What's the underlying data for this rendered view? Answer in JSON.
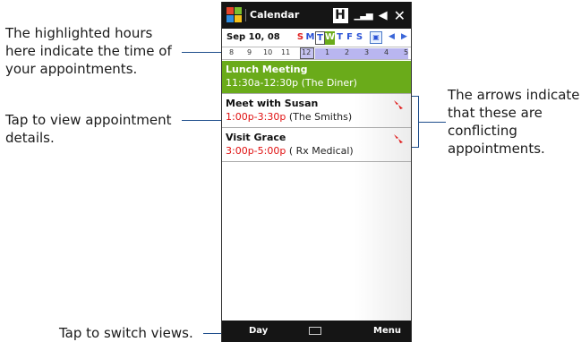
{
  "annotations": {
    "highlighted_hours": "The highlighted hours here indicate the time of your appointments.",
    "tap_view": "Tap to view appointment details.",
    "arrows": "The arrows indicate that these are conflicting appointments.",
    "switch_views": "Tap to switch views."
  },
  "phone": {
    "title": "Calendar",
    "status_h": "H",
    "date_label": "Sep 10, 08",
    "weekdays": [
      "S",
      "M",
      "T",
      "W",
      "T",
      "F",
      "S"
    ],
    "hours": [
      "8",
      "9",
      "10",
      "11",
      "12",
      "1",
      "2",
      "3",
      "4",
      "5"
    ],
    "appointments": [
      {
        "title": "Lunch Meeting",
        "time": "11:30a-12:30p",
        "location": "(The Diner)",
        "selected": true
      },
      {
        "title": "Meet with Susan",
        "time": "1:00p-3:30p",
        "location": "(The Smiths)",
        "conflict": true
      },
      {
        "title": "Visit Grace",
        "time": "3:00p-5:00p",
        "location": "( Rx Medical)",
        "conflict": true
      }
    ],
    "softkeys": {
      "left": "Day",
      "right": "Menu"
    }
  },
  "colors": {
    "selected_green": "#6aab1a",
    "time_red": "#e01010",
    "hour_highlight": "#b9b6f0",
    "annotation_line": "#1f4e8c"
  }
}
